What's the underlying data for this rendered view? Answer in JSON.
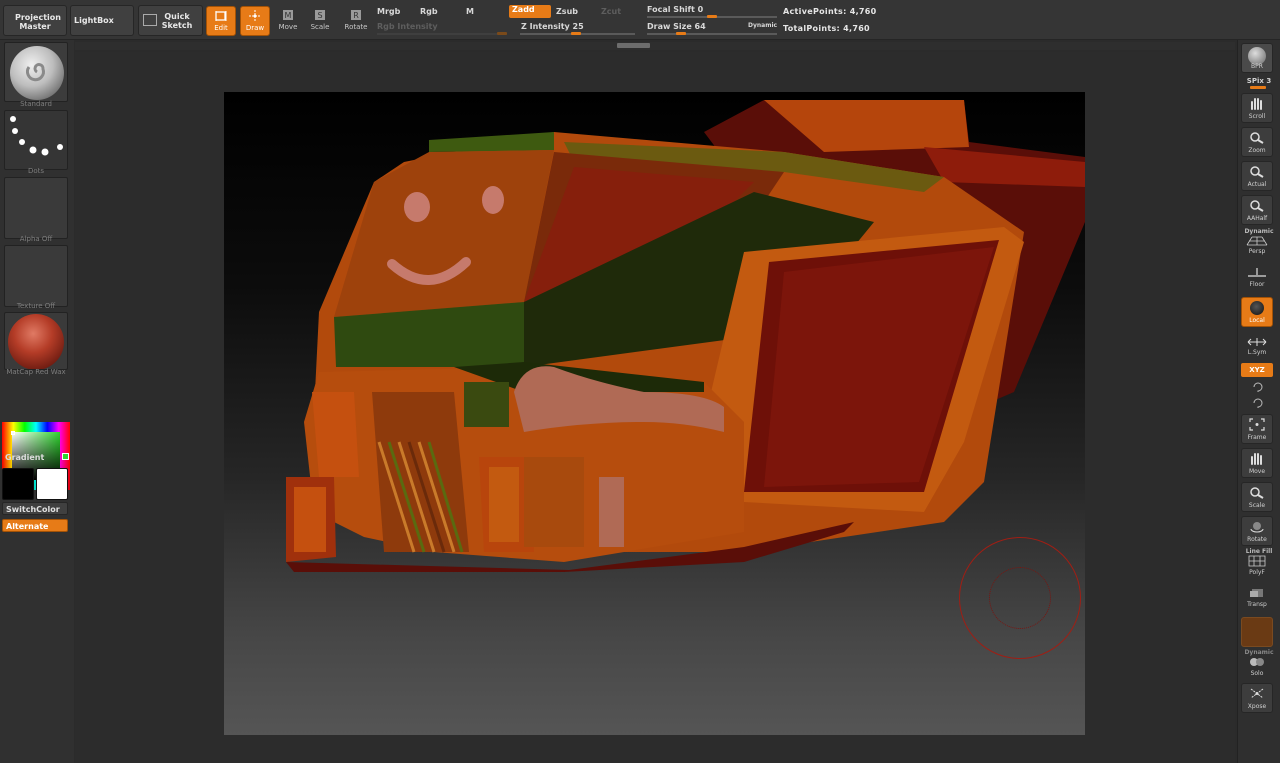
{
  "top": {
    "projection_master": "Projection Master",
    "lightbox": "LightBox",
    "quick_sketch": "Quick Sketch",
    "tools": {
      "edit": "Edit",
      "draw": "Draw",
      "move": "Move",
      "scale": "Scale",
      "rotate": "Rotate"
    },
    "mrgb": "Mrgb",
    "rgb": "Rgb",
    "m": "M",
    "zadd": "Zadd",
    "zsub": "Zsub",
    "zcut": "Zcut",
    "rgb_intensity": "Rgb Intensity",
    "z_intensity": "Z Intensity 25",
    "focal_shift": "Focal Shift 0",
    "draw_size": "Draw Size 64",
    "dynamic": "Dynamic",
    "active_points": "ActivePoints: 4,760",
    "total_points": "TotalPoints: 4,760",
    "accent_color": "#e77b17",
    "z_intensity_value": 25,
    "focal_shift_value": 0,
    "draw_size_value": 64
  },
  "left": {
    "brush": "Standard",
    "stroke": "Dots",
    "alpha": "Alpha Off",
    "texture": "Texture Off",
    "material": "MatCap Red Wax",
    "gradient": "Gradient",
    "switch_color": "SwitchColor",
    "alternate": "Alternate",
    "main_color": "#000000",
    "secondary_color": "#ffffff"
  },
  "right": {
    "bpr": "BPR",
    "spix": "SPix 3",
    "scroll": "Scroll",
    "zoom": "Zoom",
    "actual": "Actual",
    "aahalf": "AAHalf",
    "dynamic": "Dynamic",
    "persp": "Persp",
    "floor": "Floor",
    "local": "Local",
    "lsym": "L.Sym",
    "xyz": "XYZ",
    "frame": "Frame",
    "move": "Move",
    "scale": "Scale",
    "rotate": "Rotate",
    "line_fill": "Line Fill",
    "polyf": "PolyF",
    "transp": "Transp",
    "dynamic2": "Dynamic",
    "solo": "Solo",
    "xpose": "Xpose"
  }
}
